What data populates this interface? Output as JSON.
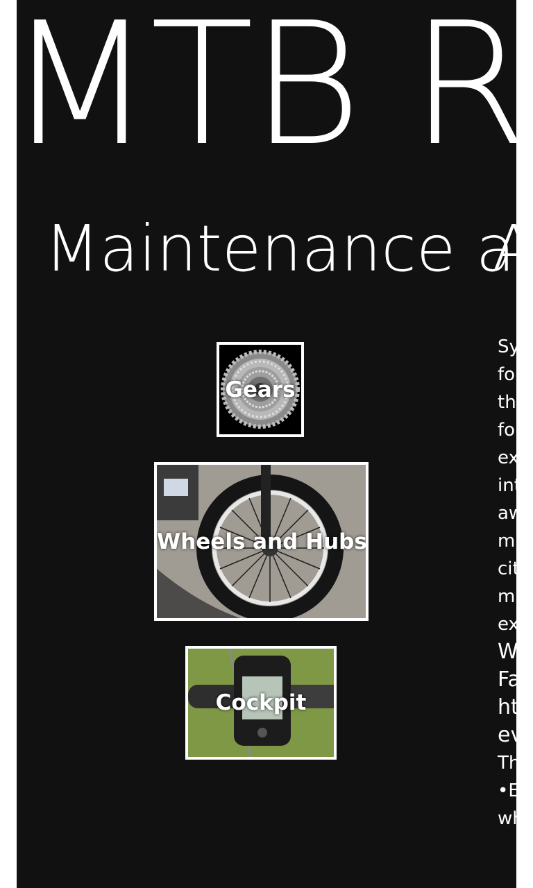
{
  "app": {
    "title": "MTB Rid"
  },
  "pivot": {
    "current": "Maintenance ar",
    "next": "A"
  },
  "tiles": [
    {
      "label": "Gears",
      "icon": "gear-cassette-photo"
    },
    {
      "label": "Wheels and Hubs",
      "icon": "bike-wheel-photo"
    },
    {
      "label": "Cockpit",
      "icon": "garmin-handlebar-photo"
    }
  ],
  "description": {
    "lines": [
      "Sy",
      "fo",
      "th",
      "fo",
      "ex",
      "int",
      "aw",
      "m",
      "cit",
      "m",
      "ex",
      "W",
      "Fa",
      "htt",
      "ev",
      "Th",
      "•E",
      "wh"
    ]
  }
}
